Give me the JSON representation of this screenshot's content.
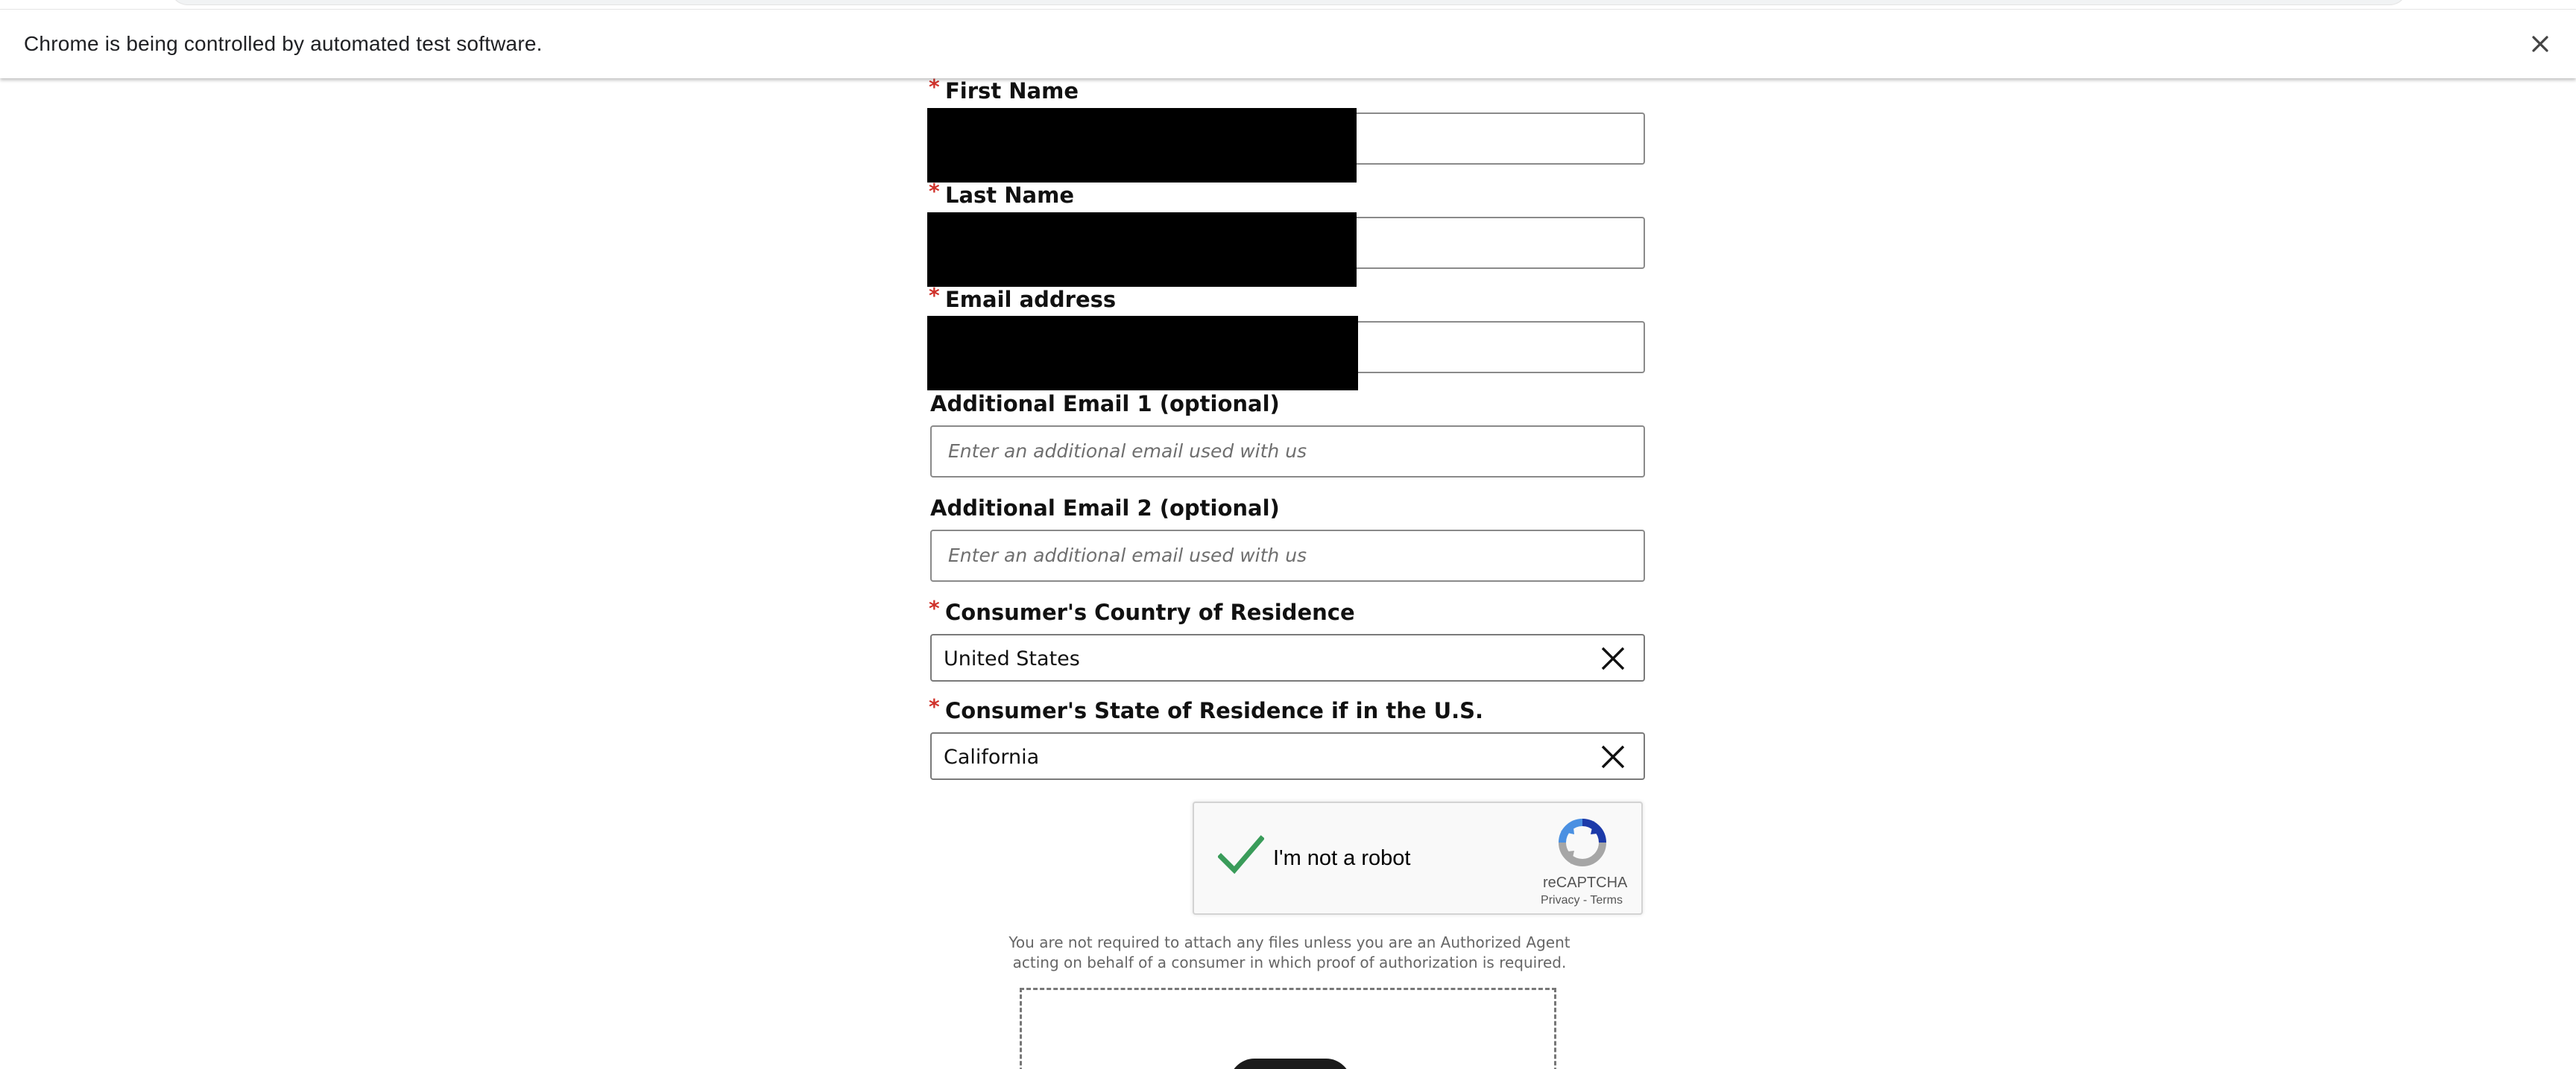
{
  "browser": {
    "automation_notice": "Chrome is being controlled by automated test software."
  },
  "form": {
    "first_name": {
      "label": "First Name",
      "required_mark": "*"
    },
    "last_name": {
      "label": "Last Name",
      "required_mark": "*"
    },
    "email": {
      "label": "Email address",
      "required_mark": "*"
    },
    "additional_email_1": {
      "label": "Additional Email 1 (optional)",
      "placeholder": "Enter an additional email used with us"
    },
    "additional_email_2": {
      "label": "Additional Email 2 (optional)",
      "placeholder": "Enter an additional email used with us"
    },
    "country": {
      "label": "Consumer's Country of Residence",
      "required_mark": "*",
      "value": "United States"
    },
    "state": {
      "label": "Consumer's State of Residence if in the U.S.",
      "required_mark": "*",
      "value": "California"
    }
  },
  "recaptcha": {
    "label": "I'm not a robot",
    "brand": "reCAPTCHA",
    "privacy": "Privacy",
    "separator": " - ",
    "terms": "Terms",
    "checked": true
  },
  "attachments": {
    "notice_line1": "You are not required to attach any files unless you are an Authorized Agent",
    "notice_line2": "acting on behalf of a consumer in which proof of authorization is required."
  },
  "colors": {
    "required": "#d0322b",
    "check": "#3a9c5a",
    "captcha_blue": "#1c3aa9",
    "captcha_lightblue": "#4a90e2",
    "captcha_gray": "#a6a6a6"
  }
}
